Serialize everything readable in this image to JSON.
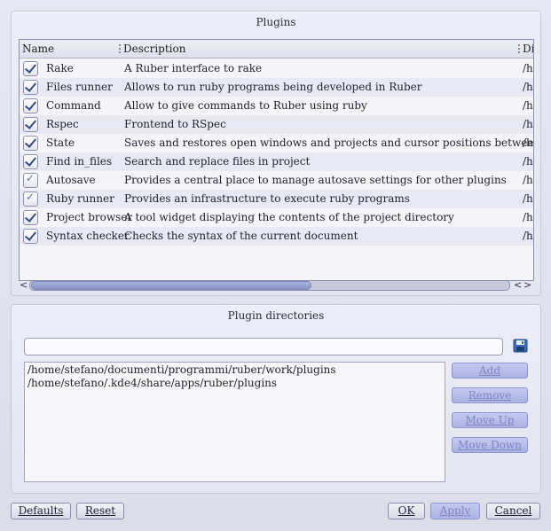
{
  "plugins_group": {
    "title": "Plugins",
    "columns": [
      "Name",
      "Description",
      "Di"
    ],
    "rows": [
      {
        "name": "Rake",
        "description": "A Ruber interface to rake",
        "dir": "/h",
        "checked": true
      },
      {
        "name": "Files runner",
        "description": "Allows to run ruby programs being developed in Ruber",
        "dir": "/h",
        "checked": true
      },
      {
        "name": "Command",
        "description": "Allow to give commands to Ruber using ruby",
        "dir": "/h",
        "checked": true
      },
      {
        "name": "Rspec",
        "description": "Frontend to RSpec",
        "dir": "/h",
        "checked": true
      },
      {
        "name": "State",
        "description": "Saves and restores open windows and projects and cursor positions between sessions",
        "dir": "/h",
        "checked": true
      },
      {
        "name": "Find in_files",
        "description": "Search and replace files in project",
        "dir": "/h",
        "checked": true
      },
      {
        "name": "Autosave",
        "description": "Provides a central place to manage autosave settings for other plugins",
        "dir": "/h",
        "checked": "partial"
      },
      {
        "name": "Ruby runner",
        "description": "Provides an infrastructure to execute ruby programs",
        "dir": "/h",
        "checked": "partial"
      },
      {
        "name": "Project browser",
        "description": "A tool widget displaying the contents of the project directory",
        "dir": "/h",
        "checked": true
      },
      {
        "name": "Syntax checker",
        "description": "Checks the syntax of the current document",
        "dir": "/h",
        "checked": true
      }
    ]
  },
  "directories_group": {
    "title": "Plugin directories",
    "input_value": "",
    "directories": [
      "/home/stefano/documenti/programmi/ruber/work/plugins",
      "/home/stefano/.kde4/share/apps/ruber/plugins"
    ],
    "buttons": {
      "add": "Add",
      "remove": "Remove",
      "move_up": "Move Up",
      "move_down": "Move Down"
    }
  },
  "dialog_buttons": {
    "defaults": "Defaults",
    "reset": "Reset",
    "ok": "OK",
    "apply": "Apply",
    "cancel": "Cancel"
  },
  "icons": {
    "save": "save-icon",
    "scroll_left": "arrow-left-icon",
    "scroll_right": "arrow-right-icon"
  }
}
